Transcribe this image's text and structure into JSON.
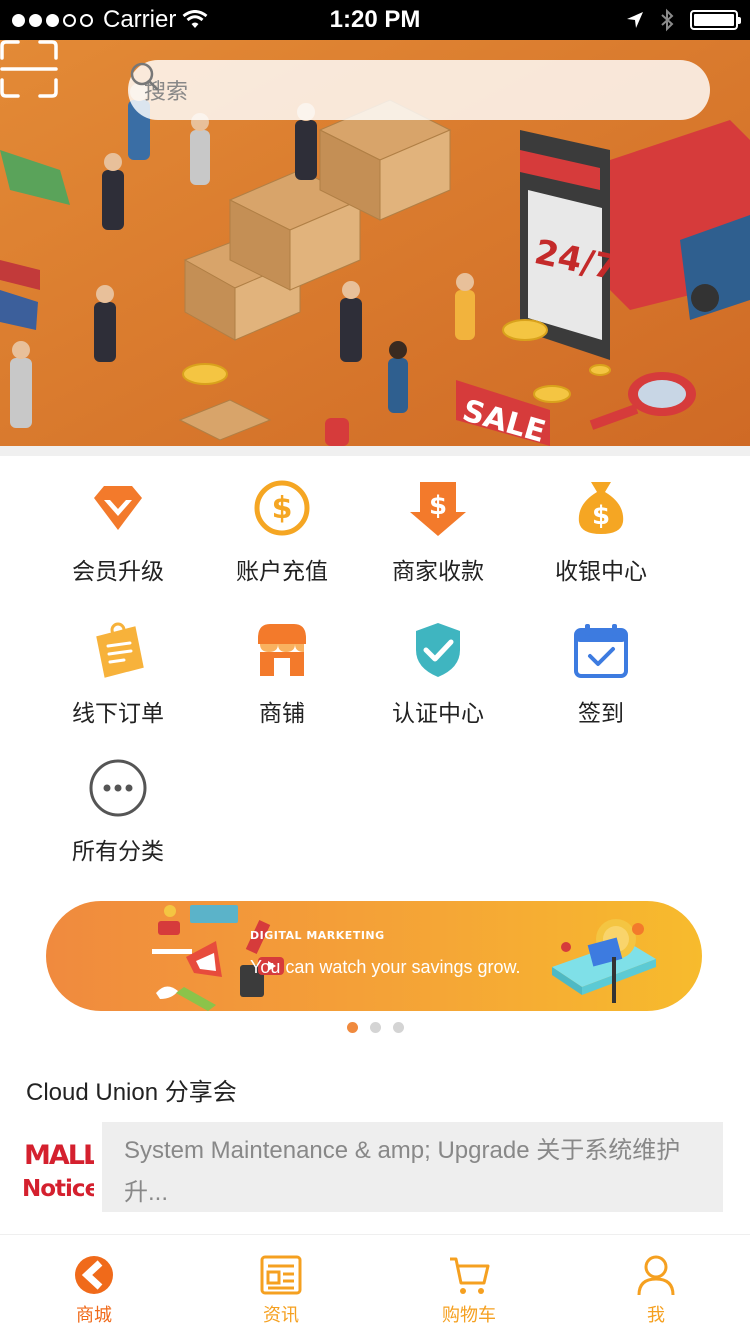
{
  "status_bar": {
    "carrier": "Carrier",
    "time": "1:20 PM",
    "signal_bars": 3
  },
  "search": {
    "placeholder": "搜索"
  },
  "grid": [
    {
      "label": "会员升级",
      "icon": "vip-diamond-icon"
    },
    {
      "label": "账户充值",
      "icon": "dollar-coin-icon"
    },
    {
      "label": "商家收款",
      "icon": "dollar-arrow-icon"
    },
    {
      "label": "收银中心",
      "icon": "money-bag-icon"
    },
    {
      "label": "线下订单",
      "icon": "order-note-icon"
    },
    {
      "label": "商铺",
      "icon": "storefront-icon"
    },
    {
      "label": "认证中心",
      "icon": "shield-check-icon"
    },
    {
      "label": "签到",
      "icon": "calendar-check-icon"
    },
    {
      "label": "所有分类",
      "icon": "more-dots-icon"
    }
  ],
  "banner": {
    "title": "DIGITAL MARKETING",
    "subtitle": "You can watch your savings grow.",
    "pages": 3,
    "active_page": 1
  },
  "news": {
    "title": "Cloud Union 分享会",
    "logo_text": [
      "MALL",
      "Notice"
    ],
    "notice_line1": "System Maintenance & amp; Upgrade 关于系统维护",
    "notice_line2": "升..."
  },
  "tabbar": [
    {
      "label": "商城",
      "icon": "mall-icon",
      "active": true
    },
    {
      "label": "资讯",
      "icon": "news-icon",
      "active": false
    },
    {
      "label": "购物车",
      "icon": "cart-icon",
      "active": false
    },
    {
      "label": "我",
      "icon": "user-icon",
      "active": false
    }
  ],
  "colors": {
    "accent": "#f06a1a",
    "tab_inactive": "#f5a020",
    "banner_start": "#f08a3e",
    "banner_end": "#f7bb2d"
  }
}
